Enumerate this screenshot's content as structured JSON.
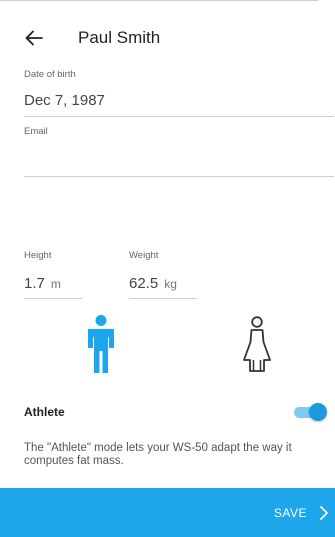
{
  "header": {
    "title": "Paul Smith",
    "back_icon": "arrow-left-icon"
  },
  "fields": {
    "date_of_birth": {
      "label": "Date of birth",
      "value": "Dec 7, 1987"
    },
    "email": {
      "label": "Email",
      "value": ""
    },
    "height": {
      "label": "Height",
      "value": "1.7",
      "unit": "m"
    },
    "weight": {
      "label": "Weight",
      "value": "62.5",
      "unit": "kg"
    }
  },
  "gender": {
    "selected": "male",
    "male_icon": "male-figure-icon",
    "female_icon": "female-figure-icon",
    "selected_color": "#1da6ec"
  },
  "athlete": {
    "label": "Athlete",
    "enabled": true,
    "description": "The \"Athlete\" mode lets your WS-50 adapt the way it computes fat mass."
  },
  "save": {
    "label": "SAVE",
    "icon": "chevron-right-icon",
    "background": "#1da6ec"
  }
}
